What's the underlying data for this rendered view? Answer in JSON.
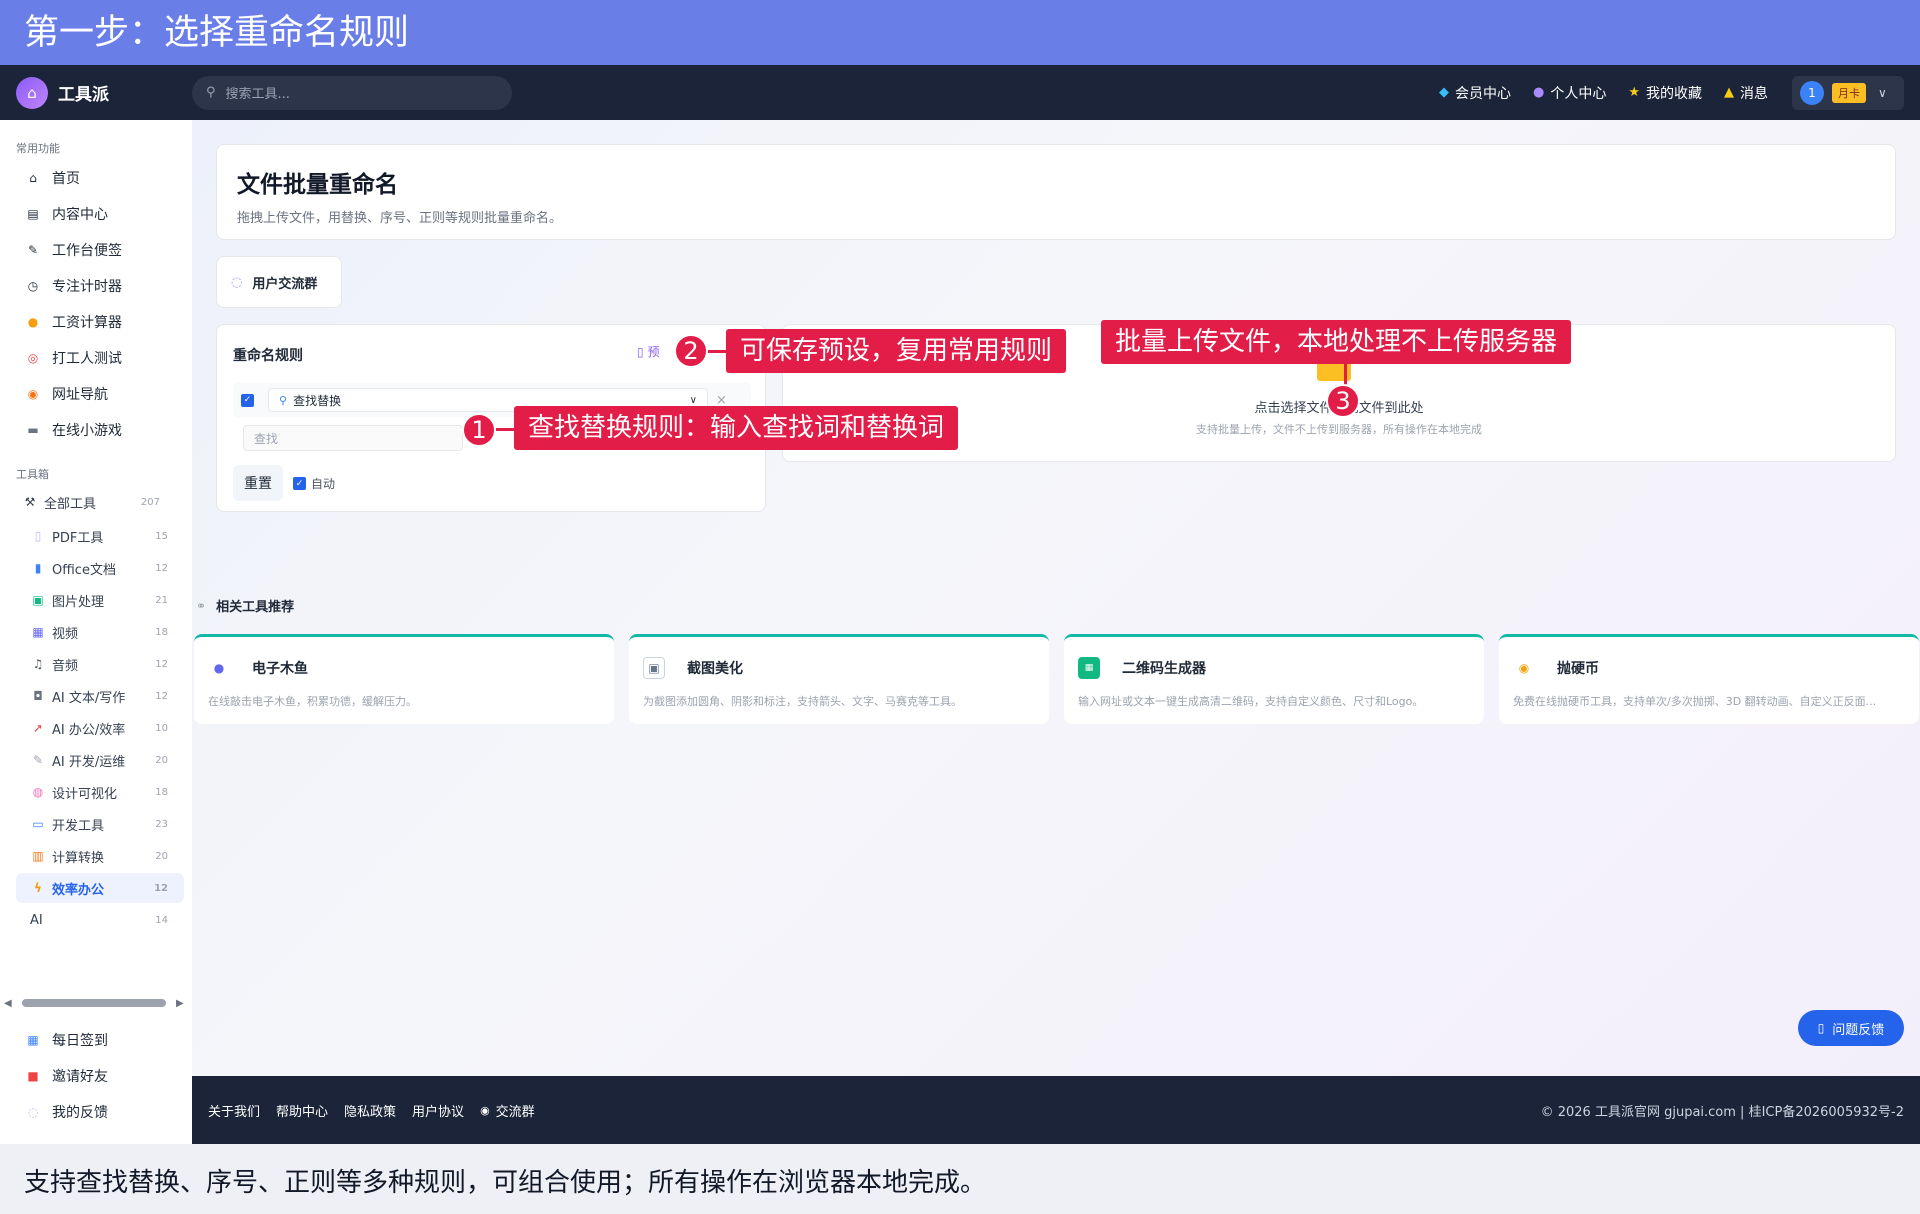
{
  "banner": {
    "title": "第一步：选择重命名规则"
  },
  "header": {
    "logo_text": "工具派",
    "search_placeholder": "搜索工具...",
    "nav": [
      {
        "label": "会员中心",
        "icon": "diamond-icon"
      },
      {
        "label": "个人中心",
        "icon": "person-icon"
      },
      {
        "label": "我的收藏",
        "icon": "star-icon"
      },
      {
        "label": "消息",
        "icon": "bell-icon"
      }
    ],
    "user": {
      "avatar": "1",
      "badge": "月卡"
    }
  },
  "sidebar": {
    "section_common": "常用功能",
    "common": [
      {
        "label": "首页",
        "icon": "house-icon"
      },
      {
        "label": "内容中心",
        "icon": "newspaper-icon"
      },
      {
        "label": "工作台便签",
        "icon": "memo-icon"
      },
      {
        "label": "专注计时器",
        "icon": "stopwatch-icon"
      },
      {
        "label": "工资计算器",
        "icon": "money-bag-icon"
      },
      {
        "label": "打工人测试",
        "icon": "target-icon"
      },
      {
        "label": "网址导航",
        "icon": "compass-icon"
      },
      {
        "label": "在线小游戏",
        "icon": "gamepad-icon"
      }
    ],
    "section_tools": "工具箱",
    "all_tools": {
      "label": "全部工具",
      "count": "207"
    },
    "tools": [
      {
        "label": "PDF工具",
        "count": "15",
        "icon": "pdf-icon"
      },
      {
        "label": "Office文档",
        "count": "12",
        "icon": "book-icon"
      },
      {
        "label": "图片处理",
        "count": "21",
        "icon": "image-icon"
      },
      {
        "label": "视频",
        "count": "18",
        "icon": "film-icon"
      },
      {
        "label": "音频",
        "count": "12",
        "icon": "music-icon"
      },
      {
        "label": "AI 文本/写作",
        "count": "12",
        "icon": "ai-icon"
      },
      {
        "label": "AI 办公/效率",
        "count": "10",
        "icon": "rocket-icon"
      },
      {
        "label": "AI 开发/运维",
        "count": "20",
        "icon": "wrench-icon"
      },
      {
        "label": "设计可视化",
        "count": "18",
        "icon": "palette-icon"
      },
      {
        "label": "开发工具",
        "count": "23",
        "icon": "computer-icon"
      },
      {
        "label": "计算转换",
        "count": "20",
        "icon": "abacus-icon"
      },
      {
        "label": "效率办公",
        "count": "12",
        "icon": "lightning-icon"
      },
      {
        "label": "AI",
        "count": "14",
        "icon": ""
      }
    ],
    "bottom": [
      {
        "label": "每日签到",
        "icon": "calendar-icon"
      },
      {
        "label": "邀请好友",
        "icon": "gift-icon"
      },
      {
        "label": "我的反馈",
        "icon": "speech-bubble-icon"
      }
    ]
  },
  "main": {
    "title": "文件批量重命名",
    "subtitle": "拖拽上传文件，用替换、序号、正则等规则批量重命名。",
    "group_btn": "用户交流群",
    "rules": {
      "title": "重命名规则",
      "preset": "预",
      "rule_type": "查找替换",
      "find_placeholder": "查找",
      "reset": "重置",
      "auto": "自动"
    },
    "upload": {
      "main": "点击选择文件、或文件到此处",
      "sub": "支持批量上传，文件不上传到服务器，所有操作在本地完成"
    },
    "related_title": "相关工具推荐",
    "related": [
      {
        "title": "电子木鱼",
        "desc": "在线敲击电子木鱼，积累功德，缓解压力。",
        "icon": "wooden-fish-icon"
      },
      {
        "title": "截图美化",
        "desc": "为截图添加圆角、阴影和标注，支持箭头、文字、马赛克等工具。",
        "icon": "screenshot-icon"
      },
      {
        "title": "二维码生成器",
        "desc": "输入网址或文本一键生成高清二维码，支持自定义颜色、尺寸和Logo。",
        "icon": "qr-icon"
      },
      {
        "title": "抛硬币",
        "desc": "免费在线抛硬币工具，支持单次/多次抛掷、3D 翻转动画、自定义正反面...",
        "icon": "coin-icon"
      }
    ],
    "feedback": "问题反馈"
  },
  "footer": {
    "links": [
      "关于我们",
      "帮助中心",
      "隐私政策",
      "用户协议",
      "交流群"
    ],
    "copyright": "© 2026 工具派官网 gjupai.com | 桂ICP备2026005932号-2"
  },
  "annotations": {
    "a1": {
      "num": "1",
      "text": "查找替换规则：输入查找词和替换词"
    },
    "a2": {
      "num": "2",
      "text": "可保存预设，复用常用规则"
    },
    "a3": {
      "num": "3",
      "text": "批量上传文件，本地处理不上传服务器"
    }
  },
  "caption": "支持查找替换、序号、正则等多种规则，可组合使用；所有操作在浏览器本地完成。"
}
